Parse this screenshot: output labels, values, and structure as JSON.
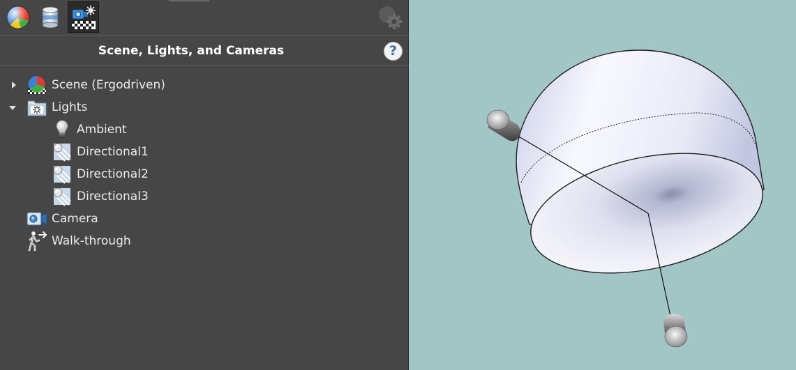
{
  "toolbar": {
    "buttons": [
      {
        "name": "appearances-tab-button",
        "icon": "color-sphere-icon",
        "active": false
      },
      {
        "name": "decals-tab-button",
        "icon": "cylinder-icon",
        "active": false
      },
      {
        "name": "scene-lights-cameras-tab-button",
        "icon": "scene-lights-cameras-icon",
        "active": true
      }
    ],
    "settings_icon": "gear-icon"
  },
  "panel": {
    "title": "Scene, Lights, and Cameras",
    "help_label": "?"
  },
  "tree": {
    "items": [
      {
        "label": "Scene (Ergodriven)",
        "icon": "scene-icon",
        "expander": "collapsed"
      },
      {
        "label": "Lights",
        "icon": "lights-folder-icon",
        "expander": "expanded"
      },
      {
        "label": "Ambient",
        "icon": "lightbulb-icon"
      },
      {
        "label": "Directional1",
        "icon": "directional-light-icon"
      },
      {
        "label": "Directional2",
        "icon": "directional-light-icon"
      },
      {
        "label": "Directional3",
        "icon": "directional-light-icon"
      },
      {
        "label": "Camera",
        "icon": "camera-icon"
      },
      {
        "label": "Walk-through",
        "icon": "walk-through-icon"
      }
    ]
  },
  "viewport": {
    "background_color": "#a1c6c5",
    "model": "hemisphere-with-light-handles"
  }
}
